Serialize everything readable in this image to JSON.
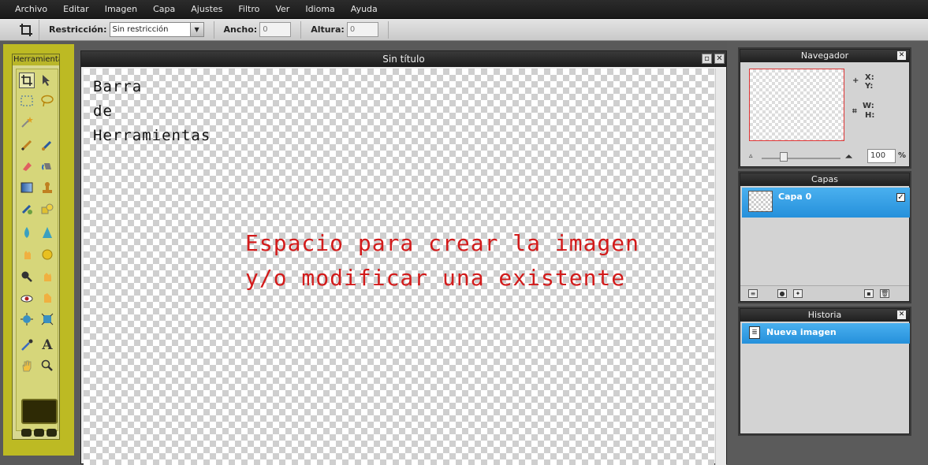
{
  "menu": [
    "Archivo",
    "Editar",
    "Imagen",
    "Capa",
    "Ajustes",
    "Filtro",
    "Ver",
    "Idioma",
    "Ayuda"
  ],
  "options": {
    "restriction_label": "Restricción:",
    "restriction_value": "Sin restricción",
    "width_label": "Ancho:",
    "width_value": "0",
    "height_label": "Altura:",
    "height_value": "0"
  },
  "tools_panel": {
    "title": "Herramientas"
  },
  "document": {
    "title": "Sin título"
  },
  "annotations": {
    "tools_lines": [
      "Barra",
      "de",
      "Herramientas"
    ],
    "canvas_lines": [
      "Espacio para crear la imagen",
      "y/o modificar una existente"
    ]
  },
  "navigator": {
    "title": "Navegador",
    "x_label": "X:",
    "y_label": "Y:",
    "w_label": "W:",
    "h_label": "H:",
    "zoom_value": "100",
    "zoom_unit": "%"
  },
  "layers": {
    "title": "Capas",
    "items": [
      {
        "name": "Capa 0",
        "visible": true
      }
    ]
  },
  "history": {
    "title": "Historia",
    "items": [
      {
        "label": "Nueva imagen"
      }
    ]
  },
  "colors": {
    "accent_selection": "#2590db",
    "tools_highlight": "#c6c21e",
    "annotation_red": "#d21b1b"
  }
}
